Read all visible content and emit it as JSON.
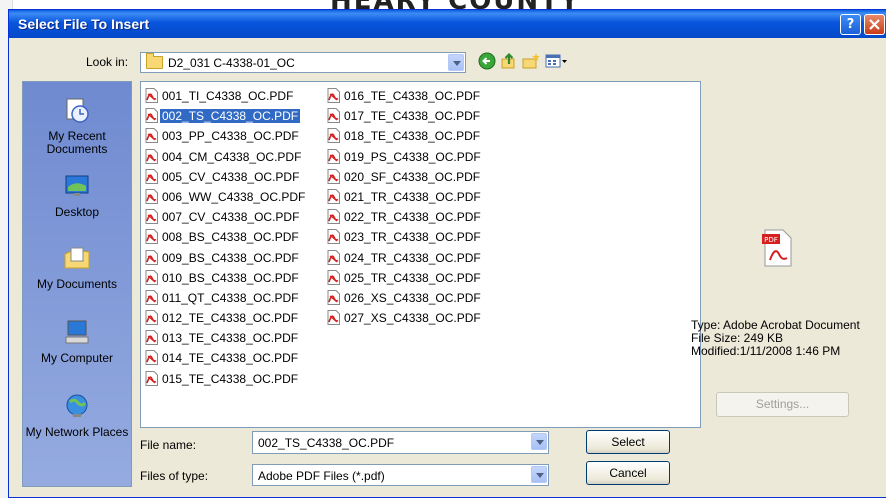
{
  "background": {
    "doc_title": "HEARY COUNTY"
  },
  "dialog": {
    "title": "Select File To Insert",
    "help_button": "?",
    "close_button": "X",
    "look_in_label": "Look in:",
    "look_in_value": "D2_031 C-4338-01_OC",
    "places": [
      {
        "label": "My Recent Documents",
        "icon": "recent-documents-icon"
      },
      {
        "label": "Desktop",
        "icon": "desktop-icon"
      },
      {
        "label": "My Documents",
        "icon": "my-documents-icon"
      },
      {
        "label": "My Computer",
        "icon": "my-computer-icon"
      },
      {
        "label": "My Network Places",
        "icon": "network-places-icon"
      }
    ],
    "files_col1": [
      "001_TI_C4338_OC.PDF",
      "002_TS_C4338_OC.PDF",
      "003_PP_C4338_OC.PDF",
      "004_CM_C4338_OC.PDF",
      "005_CV_C4338_OC.PDF",
      "006_WW_C4338_OC.PDF",
      "007_CV_C4338_OC.PDF",
      "008_BS_C4338_OC.PDF",
      "009_BS_C4338_OC.PDF",
      "010_BS_C4338_OC.PDF",
      "011_QT_C4338_OC.PDF",
      "012_TE_C4338_OC.PDF",
      "013_TE_C4338_OC.PDF",
      "014_TE_C4338_OC.PDF",
      "015_TE_C4338_OC.PDF"
    ],
    "files_col2": [
      "016_TE_C4338_OC.PDF",
      "017_TE_C4338_OC.PDF",
      "018_TE_C4338_OC.PDF",
      "019_PS_C4338_OC.PDF",
      "020_SF_C4338_OC.PDF",
      "021_TR_C4338_OC.PDF",
      "022_TR_C4338_OC.PDF",
      "023_TR_C4338_OC.PDF",
      "024_TR_C4338_OC.PDF",
      "025_TR_C4338_OC.PDF",
      "026_XS_C4338_OC.PDF",
      "027_XS_C4338_OC.PDF"
    ],
    "selected_file": "002_TS_C4338_OC.PDF",
    "preview": {
      "type_line": "Type: Adobe Acrobat Document",
      "size_line": "File Size: 249 KB",
      "modified_line": "Modified:1/11/2008 1:46 PM",
      "settings_label": "Settings..."
    },
    "file_name_label": "File name:",
    "file_name_value": "002_TS_C4338_OC.PDF",
    "files_of_type_label": "Files of type:",
    "files_of_type_value": "Adobe PDF Files (*.pdf)",
    "select_label": "Select",
    "cancel_label": "Cancel",
    "colors": {
      "titlebar": "#0855dd",
      "selection": "#316ac5",
      "places_bar": "#7b97d4"
    }
  }
}
